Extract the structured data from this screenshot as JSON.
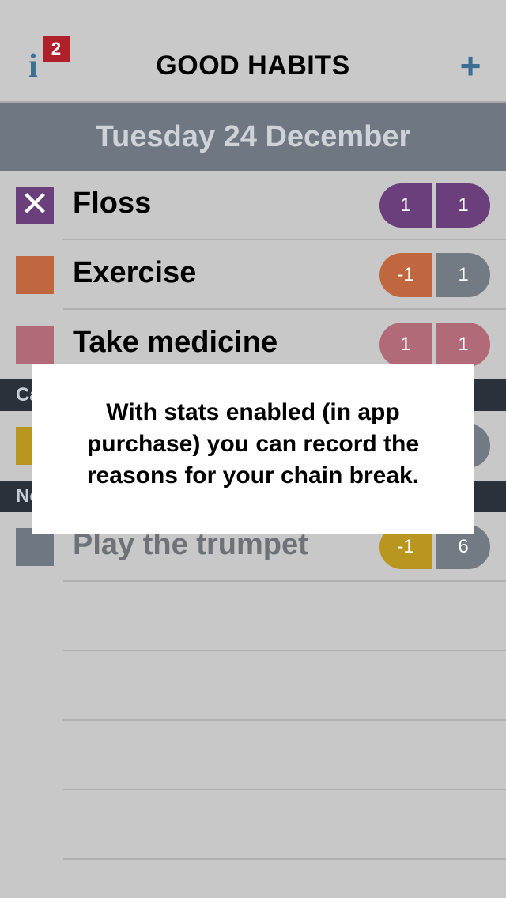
{
  "header": {
    "info_icon": "info-icon",
    "info_glyph": "i",
    "info_badge": "2",
    "title": "GOOD HABITS",
    "add_icon": "plus-icon",
    "add_glyph": "+"
  },
  "date_label": "Tuesday 24 December",
  "habits": [
    {
      "name": "Floss",
      "color": "#6b3f7c",
      "checked": true,
      "left_value": "1",
      "right_value": "1",
      "left_color": "#6b3f7c",
      "right_color": "#6b3f7c"
    },
    {
      "name": "Exercise",
      "color": "#c0673f",
      "checked": false,
      "left_value": "-1",
      "right_value": "1",
      "left_color": "#c0673f",
      "right_color": "#727a84"
    },
    {
      "name": "Take medicine",
      "color": "#b06a78",
      "checked": false,
      "left_value": "1",
      "right_value": "1",
      "left_color": "#b06a78",
      "right_color": "#b06a78"
    }
  ],
  "section_1": {
    "label": "Ca"
  },
  "section_2": {
    "label": "No"
  },
  "hidden_row": {
    "color": "#b8961f",
    "right_color": "#727a84"
  },
  "dimmed_habit": {
    "name": "Play the trumpet",
    "color": "#6e7782",
    "left_value": "-1",
    "right_value": "6",
    "left_color": "#b8961f",
    "right_color": "#727a84"
  },
  "modal": {
    "message": "With stats enabled (in app purchase) you can record the reasons for your chain break."
  },
  "colors": {
    "accent": "#3d6f94",
    "badge": "#b0202b",
    "date_bar": "#6e7782",
    "section": "#2b313a"
  }
}
